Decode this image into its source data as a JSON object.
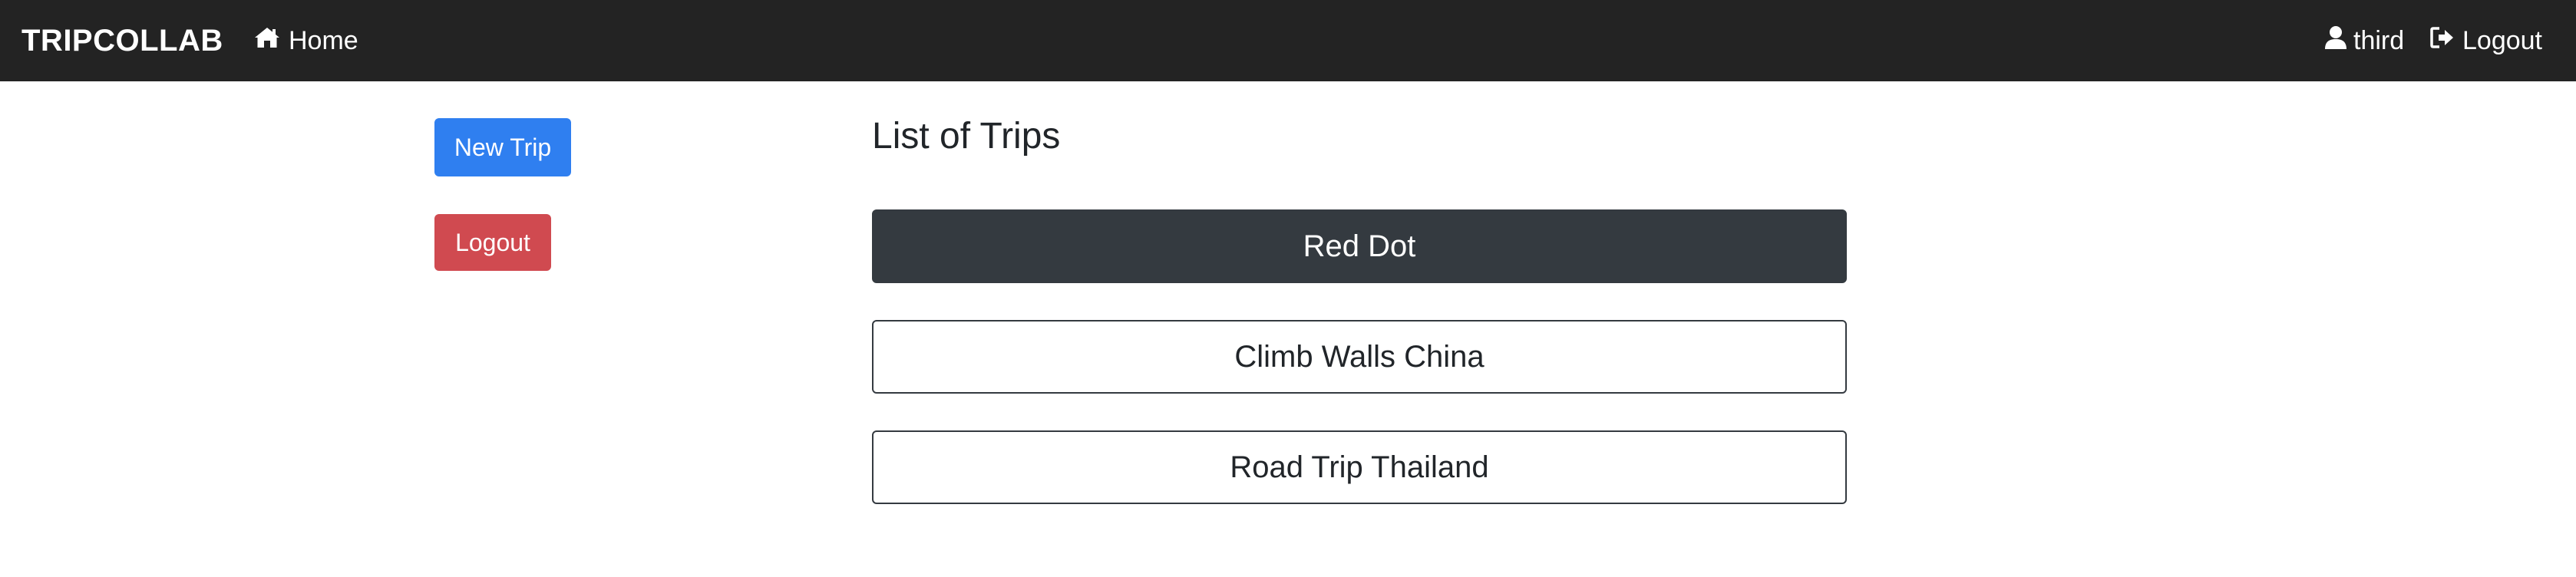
{
  "navbar": {
    "brand": "TRIPCOLLAB",
    "home_label": "Home",
    "home_icon": "home-icon",
    "user_name": "third",
    "user_icon": "user-icon",
    "logout_label": "Logout",
    "logout_icon": "sign-out-icon",
    "background": "#232323"
  },
  "sidebar": {
    "new_trip_label": "New Trip",
    "logout_label": "Logout",
    "new_trip_color": "#2f7ff0",
    "logout_color": "#d04a50"
  },
  "main": {
    "title": "List of Trips",
    "trips": [
      {
        "name": "Red Dot",
        "active": true
      },
      {
        "name": "Climb Walls China",
        "active": false
      },
      {
        "name": "Road Trip Thailand",
        "active": false
      }
    ],
    "active_color": "#343a40"
  }
}
